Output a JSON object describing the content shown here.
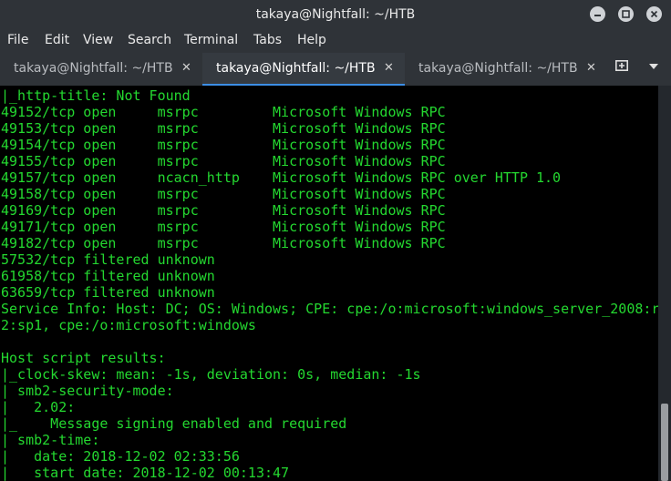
{
  "window": {
    "title": "takaya@Nightfall: ~/HTB",
    "controls": {
      "minimize_icon": "minimize-icon",
      "maximize_icon": "maximize-icon",
      "close_icon": "close-icon"
    }
  },
  "menubar": {
    "items": [
      "File",
      "Edit",
      "View",
      "Search",
      "Terminal",
      "Tabs",
      "Help"
    ]
  },
  "tabs": [
    {
      "label": "takaya@Nightfall: ~/HTB",
      "active": false
    },
    {
      "label": "takaya@Nightfall: ~/HTB",
      "active": true
    },
    {
      "label": "takaya@Nightfall: ~/HTB",
      "active": false
    }
  ],
  "tab_close_glyph": "✕",
  "terminal": {
    "foreground": "#24d830",
    "background": "#000000",
    "lines": [
      "|_http-title: Not Found",
      "49152/tcp open     msrpc         Microsoft Windows RPC",
      "49153/tcp open     msrpc         Microsoft Windows RPC",
      "49154/tcp open     msrpc         Microsoft Windows RPC",
      "49155/tcp open     msrpc         Microsoft Windows RPC",
      "49157/tcp open     ncacn_http    Microsoft Windows RPC over HTTP 1.0",
      "49158/tcp open     msrpc         Microsoft Windows RPC",
      "49169/tcp open     msrpc         Microsoft Windows RPC",
      "49171/tcp open     msrpc         Microsoft Windows RPC",
      "49182/tcp open     msrpc         Microsoft Windows RPC",
      "57532/tcp filtered unknown",
      "61958/tcp filtered unknown",
      "63659/tcp filtered unknown",
      "Service Info: Host: DC; OS: Windows; CPE: cpe:/o:microsoft:windows_server_2008:r",
      "2:sp1, cpe:/o:microsoft:windows",
      "",
      "Host script results:",
      "|_clock-skew: mean: -1s, deviation: 0s, median: -1s",
      "| smb2-security-mode:",
      "|   2.02:",
      "|_    Message signing enabled and required",
      "| smb2-time:",
      "|   date: 2018-12-02 02:33:56",
      "|   start date: 2018-12-02 00:13:47"
    ]
  }
}
